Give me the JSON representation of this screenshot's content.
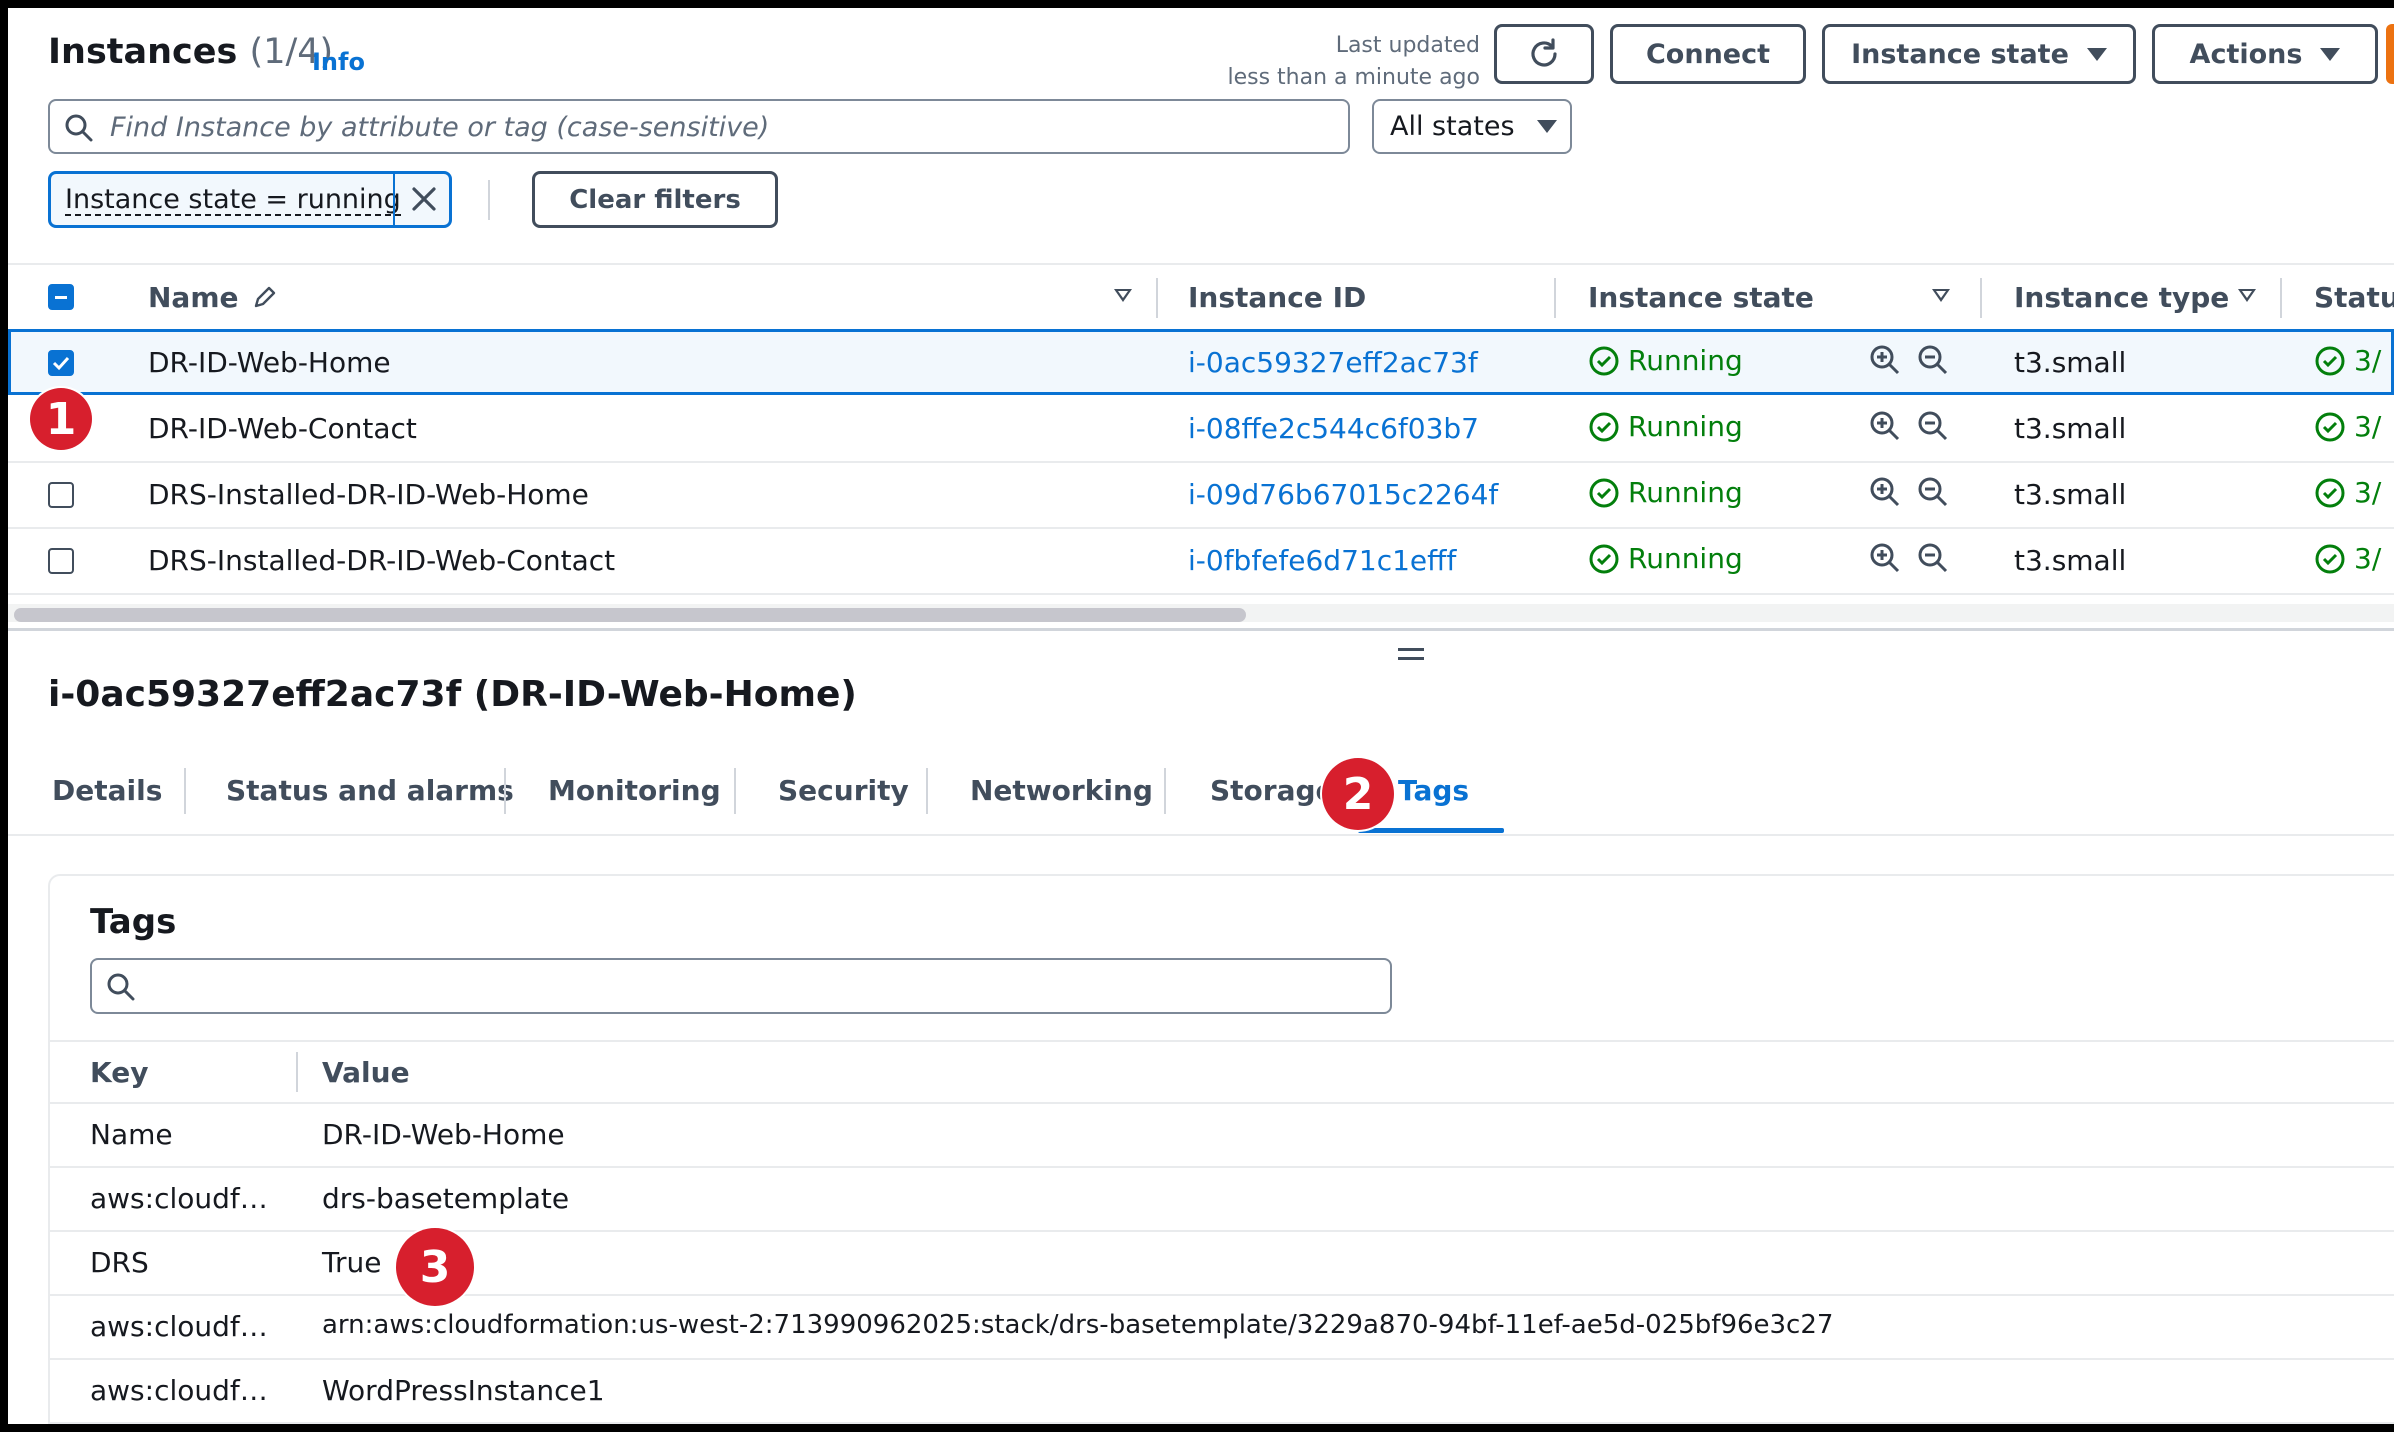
{
  "header": {
    "title": "Instances",
    "count": "(1/4)",
    "info_label": "Info",
    "last_updated_line1": "Last updated",
    "last_updated_line2": "less than a minute ago",
    "connect_label": "Connect",
    "instance_state_label": "Instance state",
    "actions_label": "Actions"
  },
  "search": {
    "placeholder": "Find Instance by attribute or tag (case-sensitive)"
  },
  "state_filter": {
    "selected": "All states"
  },
  "filter_token": {
    "label": "Instance state = running"
  },
  "clear_filters_label": "Clear filters",
  "table": {
    "columns": [
      "Name",
      "Instance ID",
      "Instance state",
      "Instance type",
      "Statu"
    ],
    "rows": [
      {
        "name": "DR-ID-Web-Home",
        "id": "i-0ac59327eff2ac73f",
        "state": "Running",
        "type": "t3.small",
        "status": "3/",
        "selected": true
      },
      {
        "name": "DR-ID-Web-Contact",
        "id": "i-08ffe2c544c6f03b7",
        "state": "Running",
        "type": "t3.small",
        "status": "3/",
        "selected": false
      },
      {
        "name": "DRS-Installed-DR-ID-Web-Home",
        "id": "i-09d76b67015c2264f",
        "state": "Running",
        "type": "t3.small",
        "status": "3/",
        "selected": false
      },
      {
        "name": "DRS-Installed-DR-ID-Web-Contact",
        "id": "i-0fbfefe6d71c1efff",
        "state": "Running",
        "type": "t3.small",
        "status": "3/",
        "selected": false
      }
    ]
  },
  "detail": {
    "title": "i-0ac59327eff2ac73f (DR-ID-Web-Home)",
    "tabs": [
      "Details",
      "Status and alarms",
      "Monitoring",
      "Security",
      "Networking",
      "Storage",
      "Tags"
    ],
    "active_tab": "Tags"
  },
  "tags": {
    "title": "Tags",
    "key_header": "Key",
    "value_header": "Value",
    "rows": [
      {
        "key": "Name",
        "value": "DR-ID-Web-Home"
      },
      {
        "key": "aws:cloudf…",
        "value": "drs-basetemplate"
      },
      {
        "key": "DRS",
        "value": "True"
      },
      {
        "key": "aws:cloudf…",
        "value": "arn:aws:cloudformation:us-west-2:713990962025:stack/drs-basetemplate/3229a870-94bf-11ef-ae5d-025bf96e3c27"
      },
      {
        "key": "aws:cloudf…",
        "value": "WordPressInstance1"
      }
    ]
  },
  "annotations": [
    "1",
    "2",
    "3"
  ],
  "colors": {
    "link": "#0972d3",
    "running": "#037f0c",
    "badge": "#d71f2d",
    "accent": "#ec7211"
  }
}
